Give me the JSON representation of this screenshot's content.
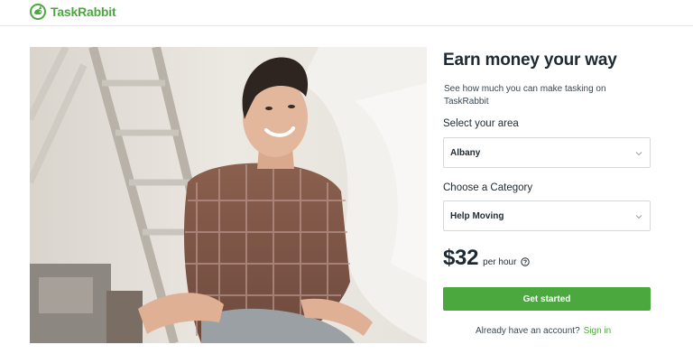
{
  "header": {
    "logo_text": "TaskRabbit"
  },
  "hero": {
    "image_subject": "woman-sitting-by-ladder"
  },
  "panel": {
    "title": "Earn money your way",
    "subtitle": "See how much you can make tasking on TaskRabbit",
    "area_label": "Select your area",
    "area_value": "Albany",
    "category_label": "Choose a Category",
    "category_value": "Help Moving",
    "price": "$32",
    "per_hour": "per hour",
    "cta_label": "Get started",
    "signin_prompt": "Already have an account?",
    "signin_link": "Sign in"
  },
  "colors": {
    "brand_green": "#4ba83e",
    "text_dark": "#1e2a32",
    "border": "#d6d9db"
  },
  "icons": [
    "rabbit-logo-icon",
    "chevron-down-icon",
    "help-circle-icon"
  ]
}
